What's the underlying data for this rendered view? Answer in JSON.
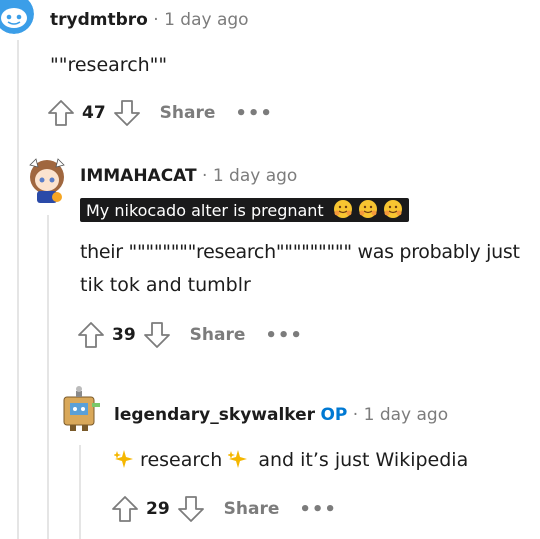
{
  "comments": [
    {
      "author": "trydmtbro",
      "separator": "·",
      "time": "1 day ago",
      "body": "\"\"research\"\"",
      "score": "47",
      "share_label": "Share",
      "more_label": "•••"
    },
    {
      "author": "IMMAHACAT",
      "separator": "·",
      "time": "1 day ago",
      "flair": "My nikocado alter is pregnant",
      "body_line1": "their \"\"\"\"\"\"\"\"research\"\"\"\"\"\"\"\"\" was probably just",
      "body_line2": "tik tok and tumblr",
      "score": "39",
      "share_label": "Share",
      "more_label": "•••"
    },
    {
      "author": "legendary_skywalker",
      "op_badge": "OP",
      "separator": "·",
      "time": "1 day ago",
      "body_word": "research",
      "body_rest": "and it’s just Wikipedia",
      "score": "29",
      "share_label": "Share",
      "more_label": "•••"
    }
  ],
  "icons": {
    "upvote": "upvote-arrow-icon",
    "downvote": "downvote-arrow-icon",
    "sparkle": "sparkles-emoji",
    "hug": "hugging-face-emoji"
  },
  "colors": {
    "op": "#0079d3",
    "muted": "#7c7c7c",
    "flair_bg": "#1a1a1b",
    "thread_line": "#e5e5e5"
  }
}
